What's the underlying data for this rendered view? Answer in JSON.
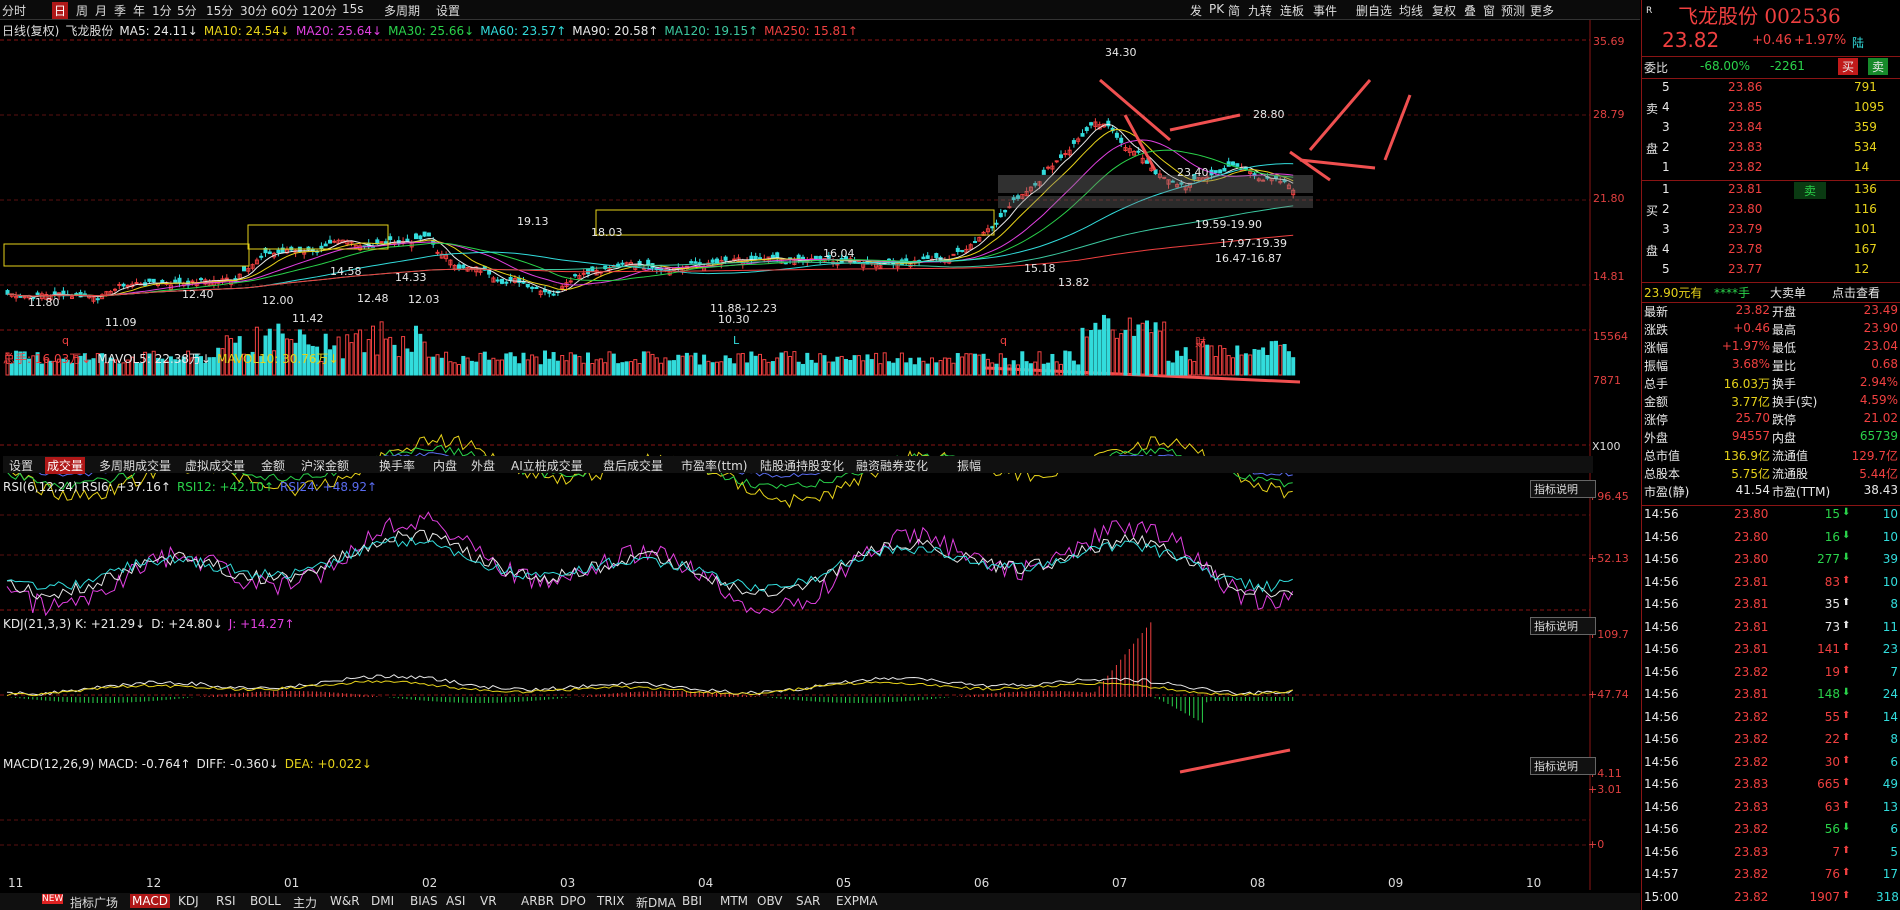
{
  "toolbar": {
    "left": [
      "分时",
      "日",
      "周",
      "月",
      "季",
      "年",
      "1分",
      "5分",
      "15分",
      "30分",
      "60分",
      "120分",
      "15s",
      "多周期",
      "设置"
    ],
    "right": [
      "发",
      "PK",
      "简",
      "九转",
      "连板",
      "事件",
      "删自选",
      "均线",
      "复权",
      "叠",
      "窗",
      "预测",
      "更多"
    ]
  },
  "chart_header": {
    "label": "日线(复权)",
    "stock": "飞龙股份",
    "ma": [
      {
        "t": "MA5: 24.11↓",
        "c": "#e8e8e8"
      },
      {
        "t": "MA10: 24.54↓",
        "c": "#e6d21a"
      },
      {
        "t": "MA20: 25.64↓",
        "c": "#e040e0"
      },
      {
        "t": "MA30: 25.66↓",
        "c": "#2ad24a"
      },
      {
        "t": "MA60: 23.57↑",
        "c": "#32dcdc"
      },
      {
        "t": "MA90: 20.58↑",
        "c": "#e8e8e8"
      },
      {
        "t": "MA120: 19.15↑",
        "c": "#3cc8a0"
      },
      {
        "t": "MA250: 15.81↑",
        "c": "#f04040"
      }
    ]
  },
  "price_axis": [
    "35.69",
    "28.79",
    "21.80",
    "14.81"
  ],
  "vol_axis": [
    "15564",
    "7871",
    "X100"
  ],
  "rsi_axis": [
    "+96.45",
    "+52.13"
  ],
  "kdj_axis": [
    "+109.7",
    "+47.74"
  ],
  "macd_axis": [
    "+4.11",
    "+3.01",
    "+0"
  ],
  "annotations": [
    "34.30",
    "28.80",
    "23.40",
    "19.13",
    "18.03",
    "16.04",
    "15.18",
    "14.58",
    "14.33",
    "13.82",
    "12.48",
    "12.40",
    "12.03",
    "12.00",
    "11.80",
    "11.09",
    "11.42",
    "10.30",
    "11.88-12.23",
    "19.59-19.90",
    "17.97-19.39",
    "16.47-16.87"
  ],
  "bottom_markers": [
    "q",
    "L",
    "q",
    "财"
  ],
  "vol_title": [
    {
      "t": "总手: 16.03万↓",
      "c": "#f04040"
    },
    {
      "t": "MAVOL5: 22.38万↓",
      "c": "#e8e8e8"
    },
    {
      "t": "MAVOL10: 30.76万↓",
      "c": "#e6d21a"
    }
  ],
  "vol_tabs": [
    "设置",
    "成交量",
    "多周期成交量",
    "虚拟成交量",
    "金额",
    "沪深金额",
    "换手率",
    "内盘",
    "外盘",
    "AI立桩成交量",
    "盘后成交量",
    "市盈率(ttm)",
    "陆股通持股变化",
    "融资融券变化",
    "振幅"
  ],
  "rsi_title": [
    {
      "t": "RSI(6,12,24) RSI6: +37.16↑",
      "c": "#e8e8e8"
    },
    {
      "t": "RSI12: +42.10↑",
      "c": "#2ad24a"
    },
    {
      "t": "RSI24: +48.92↑",
      "c": "#5a6cf0"
    }
  ],
  "kdj_title": [
    {
      "t": "KDJ(21,3,3) K: +21.29↓",
      "c": "#e8e8e8"
    },
    {
      "t": "D: +24.80↓",
      "c": "#e8e8e8"
    },
    {
      "t": "J: +14.27↑",
      "c": "#e040e0"
    }
  ],
  "macd_title": [
    {
      "t": "MACD(12,26,9) MACD: -0.764↑",
      "c": "#e8e8e8"
    },
    {
      "t": "DIFF: -0.360↓",
      "c": "#e8e8e8"
    },
    {
      "t": "DEA: +0.022↓",
      "c": "#e6d21a"
    }
  ],
  "indicator_button": "指标说明",
  "months": [
    "11",
    "12",
    "01",
    "02",
    "03",
    "04",
    "05",
    "06",
    "07",
    "08",
    "09",
    "10"
  ],
  "bottom_tabs": [
    "指标广场",
    "MACD",
    "KDJ",
    "RSI",
    "BOLL",
    "主力",
    "W&R",
    "DMI",
    "BIAS",
    "ASI",
    "VR",
    "ARBR",
    "DPO",
    "TRIX",
    "新DMA",
    "BBI",
    "MTM",
    "OBV",
    "SAR",
    "EXPMA"
  ],
  "new_badge": "NEW",
  "right_panel": {
    "name": "飞龙股份 002536",
    "mark": "R",
    "price": "23.82",
    "change": "+0.46",
    "pct": "+1.97%",
    "tag": "陆",
    "weibi_label": "委比",
    "weibi": "-68.00%",
    "weicha": "-2261",
    "buy_btn": "买",
    "sell_btn": "卖",
    "asks": [
      {
        "n": "5",
        "p": "23.86",
        "v": "791"
      },
      {
        "n": "4",
        "p": "23.85",
        "v": "1095"
      },
      {
        "n": "3",
        "p": "23.84",
        "v": "359"
      },
      {
        "n": "2",
        "p": "23.83",
        "v": "534"
      },
      {
        "n": "1",
        "p": "23.82",
        "v": "14"
      }
    ],
    "bids": [
      {
        "n": "1",
        "p": "23.81",
        "v": "136",
        "tag": "卖"
      },
      {
        "n": "2",
        "p": "23.80",
        "v": "116"
      },
      {
        "n": "3",
        "p": "23.79",
        "v": "101"
      },
      {
        "n": "4",
        "p": "23.78",
        "v": "167"
      },
      {
        "n": "5",
        "p": "23.77",
        "v": "12"
      }
    ],
    "side_sell": [
      "卖",
      "盘"
    ],
    "side_buy": [
      "买",
      "盘"
    ],
    "big": {
      "a": "23.90元有",
      "b": "****手",
      "c": "大卖单",
      "d": "点击查看"
    },
    "stats": [
      [
        "最新",
        "23.82",
        "开盘",
        "23.49"
      ],
      [
        "涨跌",
        "+0.46",
        "最高",
        "23.90"
      ],
      [
        "涨幅",
        "+1.97%",
        "最低",
        "23.04"
      ],
      [
        "振幅",
        "3.68%",
        "量比",
        "0.68"
      ],
      [
        "总手",
        "16.03万",
        "换手",
        "2.94%"
      ],
      [
        "金额",
        "3.77亿",
        "换手(实)",
        "4.59%"
      ],
      [
        "涨停",
        "25.70",
        "跌停",
        "21.02"
      ],
      [
        "外盘",
        "94557",
        "内盘",
        "65739"
      ],
      [
        "总市值",
        "136.9亿",
        "流通值",
        "129.7亿"
      ],
      [
        "总股本",
        "5.75亿",
        "流通股",
        "5.44亿"
      ],
      [
        "市盈(静)",
        "41.54",
        "市盈(TTM)",
        "38.43"
      ]
    ],
    "ticks": [
      [
        "14:56",
        "23.80",
        "15",
        "down",
        "10"
      ],
      [
        "14:56",
        "23.80",
        "16",
        "down",
        "10"
      ],
      [
        "14:56",
        "23.80",
        "277",
        "down",
        "39"
      ],
      [
        "14:56",
        "23.81",
        "83",
        "up",
        "10"
      ],
      [
        "14:56",
        "23.81",
        "35",
        "upw",
        "8"
      ],
      [
        "14:56",
        "23.81",
        "73",
        "upw",
        "11"
      ],
      [
        "14:56",
        "23.81",
        "141",
        "up",
        "23"
      ],
      [
        "14:56",
        "23.82",
        "19",
        "up",
        "7"
      ],
      [
        "14:56",
        "23.81",
        "148",
        "down",
        "24"
      ],
      [
        "14:56",
        "23.82",
        "55",
        "up",
        "14"
      ],
      [
        "14:56",
        "23.82",
        "22",
        "up",
        "8"
      ],
      [
        "14:56",
        "23.82",
        "30",
        "up",
        "6"
      ],
      [
        "14:56",
        "23.83",
        "665",
        "up",
        "49"
      ],
      [
        "14:56",
        "23.83",
        "63",
        "up",
        "13"
      ],
      [
        "14:56",
        "23.82",
        "56",
        "down",
        "6"
      ],
      [
        "14:56",
        "23.83",
        "7",
        "up",
        "5"
      ],
      [
        "14:57",
        "23.82",
        "76",
        "up",
        "17"
      ],
      [
        "15:00",
        "23.82",
        "1907",
        "up",
        "318"
      ]
    ]
  }
}
